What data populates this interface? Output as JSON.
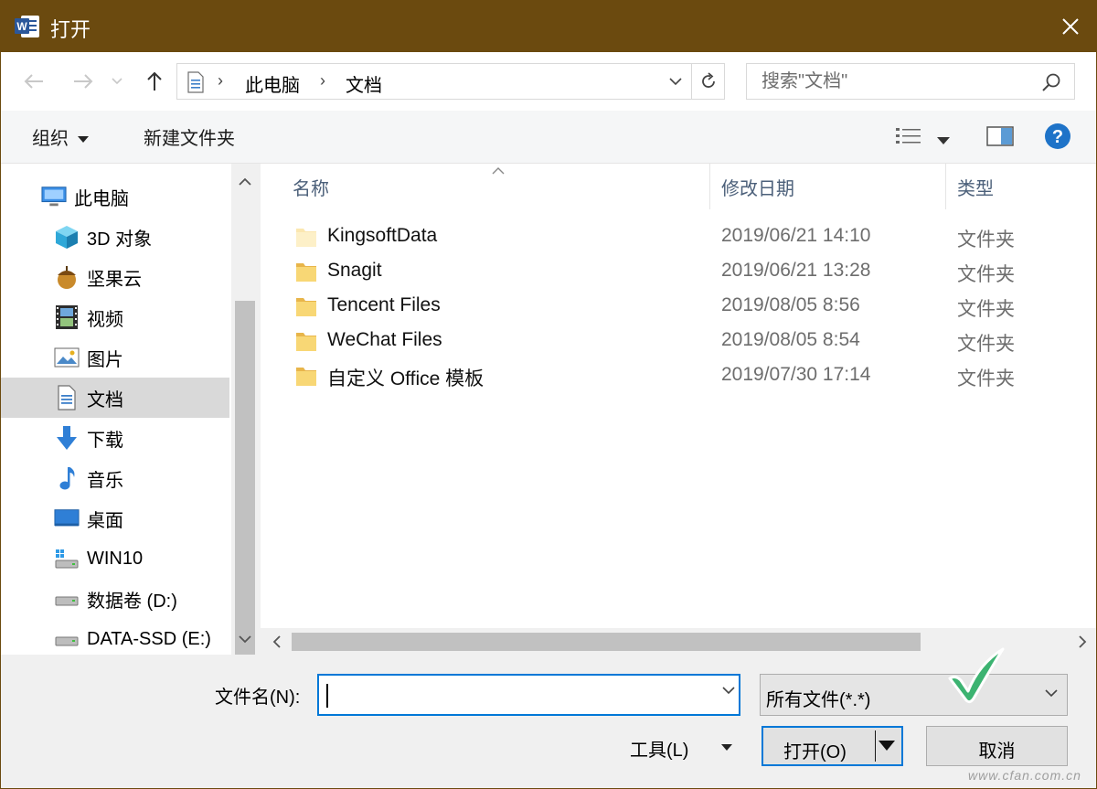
{
  "window": {
    "title": "打开",
    "app_icon_letter": "W"
  },
  "address": {
    "crumbs": [
      "此电脑",
      "文档"
    ],
    "search_placeholder": "搜索\"文档\""
  },
  "toolbar": {
    "organize_label": "组织",
    "new_folder_label": "新建文件夹"
  },
  "nav": {
    "items": [
      {
        "label": "此电脑",
        "icon": "computer-icon"
      },
      {
        "label": "3D 对象",
        "icon": "3d-objects-icon"
      },
      {
        "label": "坚果云",
        "icon": "nutstore-icon"
      },
      {
        "label": "视频",
        "icon": "video-icon"
      },
      {
        "label": "图片",
        "icon": "pictures-icon"
      },
      {
        "label": "文档",
        "icon": "documents-icon",
        "selected": true
      },
      {
        "label": "下载",
        "icon": "download-icon"
      },
      {
        "label": "音乐",
        "icon": "music-icon"
      },
      {
        "label": "桌面",
        "icon": "desktop-icon"
      },
      {
        "label": "WIN10",
        "icon": "system-drive-icon"
      },
      {
        "label": "数据卷 (D:)",
        "icon": "drive-icon"
      },
      {
        "label": "DATA-SSD (E:)",
        "icon": "drive-icon"
      }
    ]
  },
  "columns": {
    "name": "名称",
    "modified": "修改日期",
    "type": "类型"
  },
  "files": [
    {
      "name": "KingsoftData",
      "date": "2019/06/21 14:10",
      "type": "文件夹"
    },
    {
      "name": "Snagit",
      "date": "2019/06/21 13:28",
      "type": "文件夹"
    },
    {
      "name": "Tencent Files",
      "date": "2019/08/05 8:56",
      "type": "文件夹"
    },
    {
      "name": "WeChat Files",
      "date": "2019/08/05 8:54",
      "type": "文件夹"
    },
    {
      "name": "自定义 Office 模板",
      "date": "2019/07/30 17:14",
      "type": "文件夹"
    }
  ],
  "bottom": {
    "filename_label": "文件名(N):",
    "filename_value": "",
    "filter_value": "所有文件(*.*)",
    "tools_label": "工具(L)",
    "open_label": "打开(O)",
    "cancel_label": "取消",
    "watermark": "www.cfan.com.cn"
  },
  "colors": {
    "titlebar": "#6b4a0f",
    "accent": "#0078d7",
    "check": "#3cb371",
    "folder": "#f8d775"
  }
}
